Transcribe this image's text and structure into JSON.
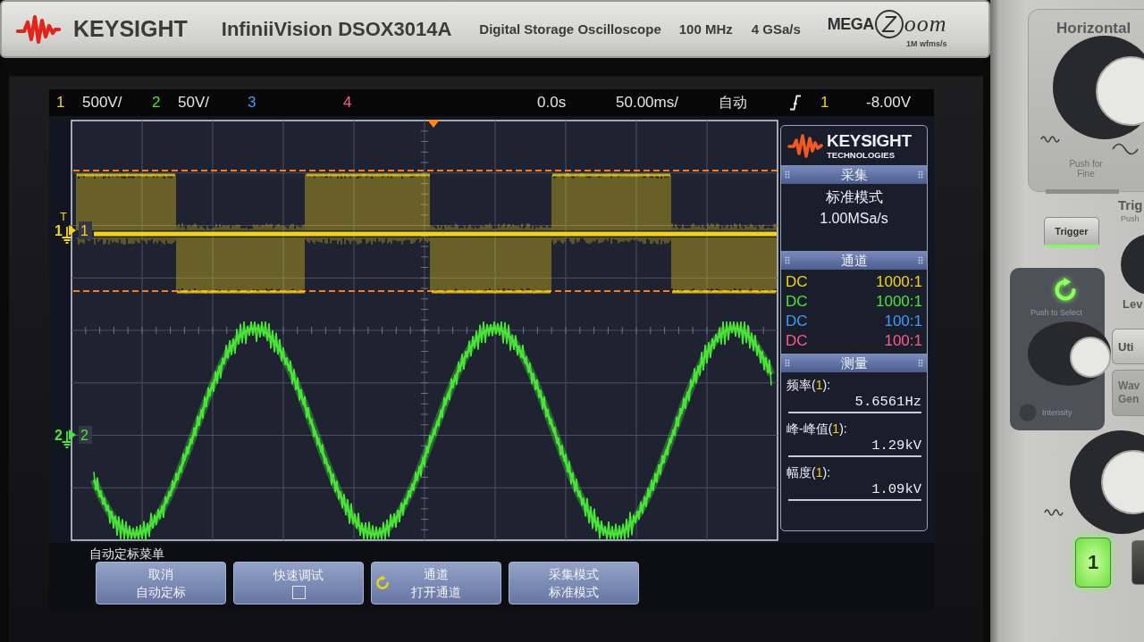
{
  "device_header": {
    "brand": "KEYSIGHT",
    "model": "InfiniiVision DSOX3014A",
    "description": "Digital Storage Oscilloscope",
    "bandwidth": "100 MHz",
    "sample_rate": "4 GSa/s",
    "megazoom": {
      "prefix": "MEGA",
      "letter": "Z",
      "suffix": "oom",
      "caption": "1M wfms/s"
    }
  },
  "status_bar": {
    "channels": [
      {
        "number": "1",
        "scale": "500V/",
        "color": "#f2d21c"
      },
      {
        "number": "2",
        "scale": "50V/",
        "color": "#4be33a"
      },
      {
        "number": "3",
        "color": "#3d9bff"
      },
      {
        "number": "4",
        "color": "#ff5a8c"
      }
    ],
    "time_delay": "0.0s",
    "time_scale": "50.00ms/",
    "trigger": {
      "mode": "自动",
      "source": "1",
      "color": "#f2d21c",
      "level": "-8.00V"
    }
  },
  "waveform_display": {
    "markers": [
      {
        "channel": "1",
        "label": "1",
        "trigger_mark": "T",
        "color": "#f2d21c"
      },
      {
        "channel": "2",
        "label": "2",
        "color": "#4be33a"
      }
    ],
    "traces": [
      {
        "kind": "square",
        "color": "#f2d21c"
      },
      {
        "kind": "sine",
        "color": "#4be33a"
      }
    ]
  },
  "info_panel": {
    "logo": {
      "brand": "KEYSIGHT",
      "tagline": "TECHNOLOGIES"
    },
    "acquisition": {
      "title": "采集",
      "mode": "标准模式",
      "sample_rate": "1.00MSa/s"
    },
    "channels": {
      "title": "通道",
      "rows": [
        {
          "coupling": "DC",
          "probe": "1000:1",
          "color": "#f2d21c"
        },
        {
          "coupling": "DC",
          "probe": "1000:1",
          "color": "#4be33a"
        },
        {
          "coupling": "DC",
          "probe": "100:1",
          "color": "#3d9bff"
        },
        {
          "coupling": "DC",
          "probe": "100:1",
          "color": "#ff5a8c"
        }
      ]
    },
    "measurements": {
      "title": "测量",
      "items": [
        {
          "label_start": "频率(",
          "source": "1",
          "label_end": "):",
          "value": "5.6561Hz",
          "color": "#f2d21c"
        },
        {
          "label_start": "峰-峰值(",
          "source": "1",
          "label_end": "):",
          "value": "1.29kV",
          "color": "#f2d21c"
        },
        {
          "label_start": "幅度(",
          "source": "1",
          "label_end": "):",
          "value": "1.09kV",
          "color": "#f2d21c"
        }
      ]
    }
  },
  "softkey_menu": {
    "title": "自动定标菜单",
    "keys": [
      {
        "kind": "text",
        "top": "取消",
        "bottom": "自动定标"
      },
      {
        "kind": "checkbox",
        "top": "快速调试",
        "checked": false
      },
      {
        "kind": "knob",
        "top": "通道",
        "bottom": "打开通道"
      },
      {
        "kind": "text",
        "top": "采集模式",
        "bottom": "标准模式"
      }
    ]
  },
  "front_panel": {
    "horizontal": {
      "title": "Horizontal",
      "hint": "Push for Fine"
    },
    "trigger": {
      "title": "Trig",
      "hint": "Push",
      "button": "Trigger",
      "led_on": true,
      "level_label": "Lev"
    },
    "entry": {
      "hint": "Push to Select",
      "intensity_label": "Intensity"
    },
    "side_buttons": [
      {
        "lines": [
          "Uti"
        ]
      },
      {
        "lines": [
          "Wav",
          "Gen"
        ]
      }
    ],
    "channel_key": {
      "label": "1",
      "on": true
    }
  }
}
